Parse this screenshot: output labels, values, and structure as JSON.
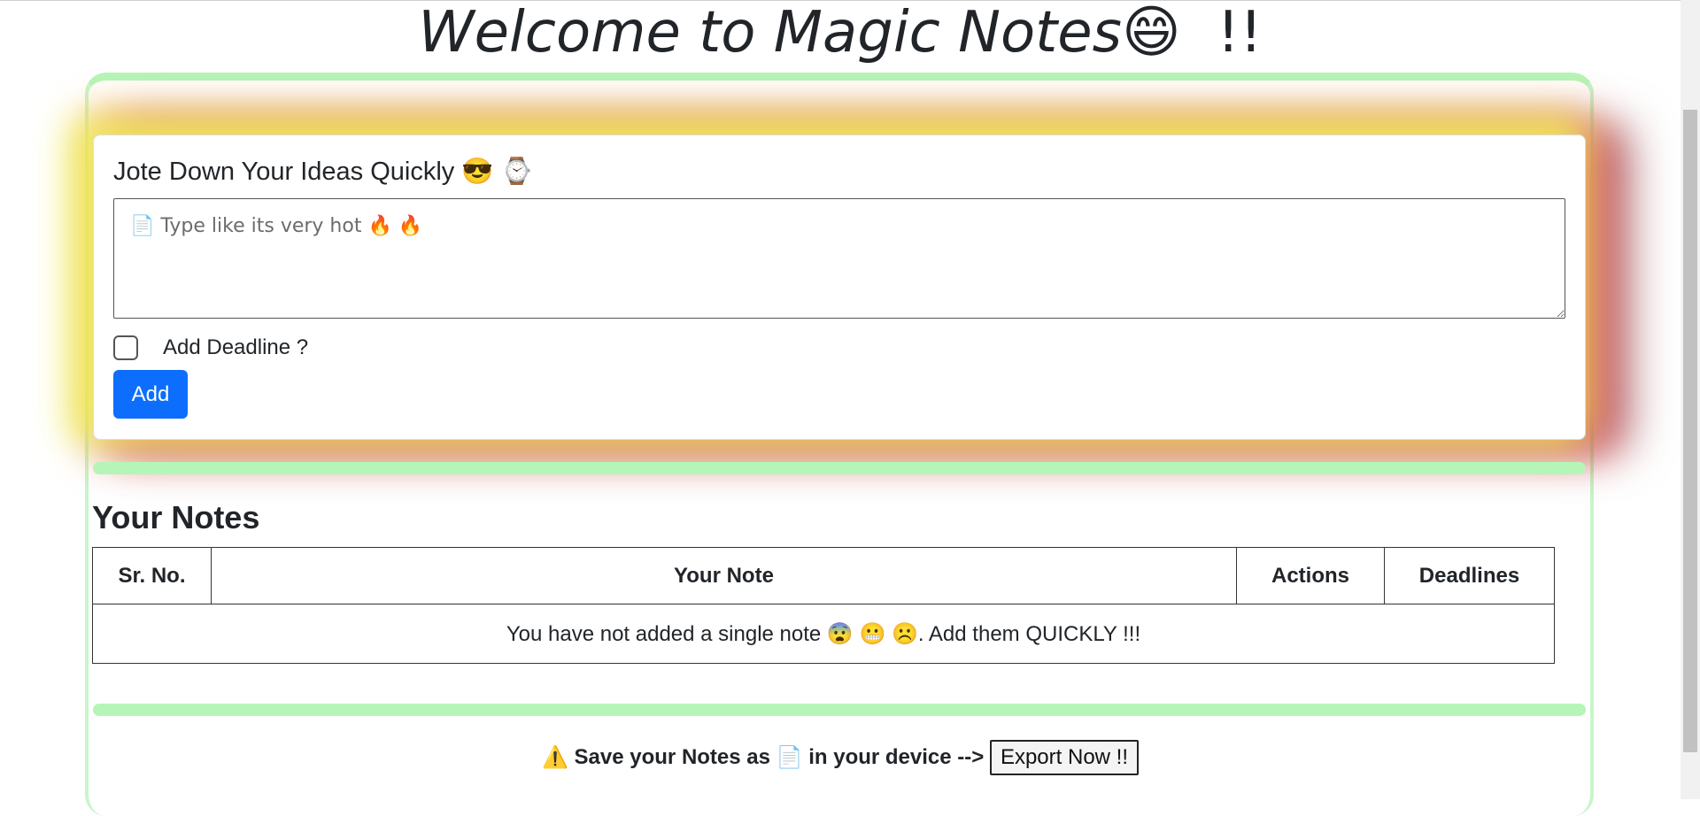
{
  "page": {
    "title_text": "Welcome to Magic Notes",
    "title_emoji": "😄",
    "title_suffix": "!!"
  },
  "colors": {
    "accent_green": "#b6f5b8",
    "primary_button": "#0d6efd"
  },
  "form": {
    "heading": "Jote Down Your Ideas Quickly 😎 ⌚",
    "textarea_placeholder": "📄 Type like its very hot 🔥 🔥",
    "textarea_value": "",
    "deadline_label": "Add Deadline ?",
    "deadline_checked": false,
    "add_label": "Add"
  },
  "notes": {
    "heading": "Your Notes",
    "columns": [
      "Sr. No.",
      "Your Note",
      "Actions",
      "Deadlines"
    ],
    "empty_message": "You have not added a single note 😨 😬 ☹️. Add them QUICKLY !!!"
  },
  "footer": {
    "warning_icon": "⚠️",
    "text_before": "Save your Notes as",
    "file_icon": "📄",
    "text_after": "in your device -->",
    "export_label": "Export Now !!"
  }
}
